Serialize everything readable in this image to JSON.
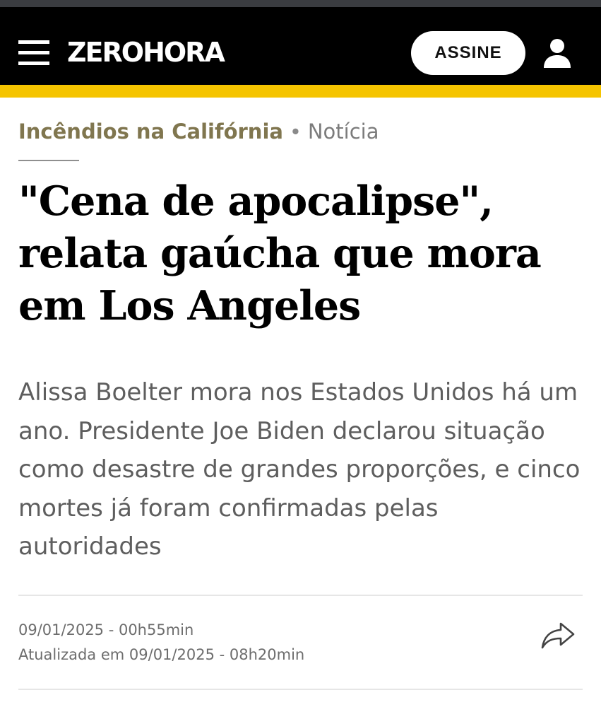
{
  "header": {
    "logo_text": "ZEROHORA",
    "subscribe_label": "ASSINE",
    "menu_icon": "hamburger-menu-icon",
    "user_icon": "user-icon",
    "background_color": "#000000",
    "accent_color": "#f5c400"
  },
  "article": {
    "kicker_topic": "Incêndios na Califórnia",
    "kicker_separator": "•",
    "kicker_type": "Notícia",
    "headline": "\"Cena de apocalipse\", relata gaúcha que mora em Los Angeles",
    "subtitle": "Alissa Boelter mora nos Estados Unidos há um ano. Presidente Joe Biden declarou situação como desastre de grandes proporções, e cinco mortes já foram confirmadas pelas autoridades",
    "published": "09/01/2025 - 00h55min",
    "updated": "Atualizada em 09/01/2025 - 08h20min",
    "share_icon": "share-arrow-icon",
    "kicker_color": "#80764f"
  }
}
